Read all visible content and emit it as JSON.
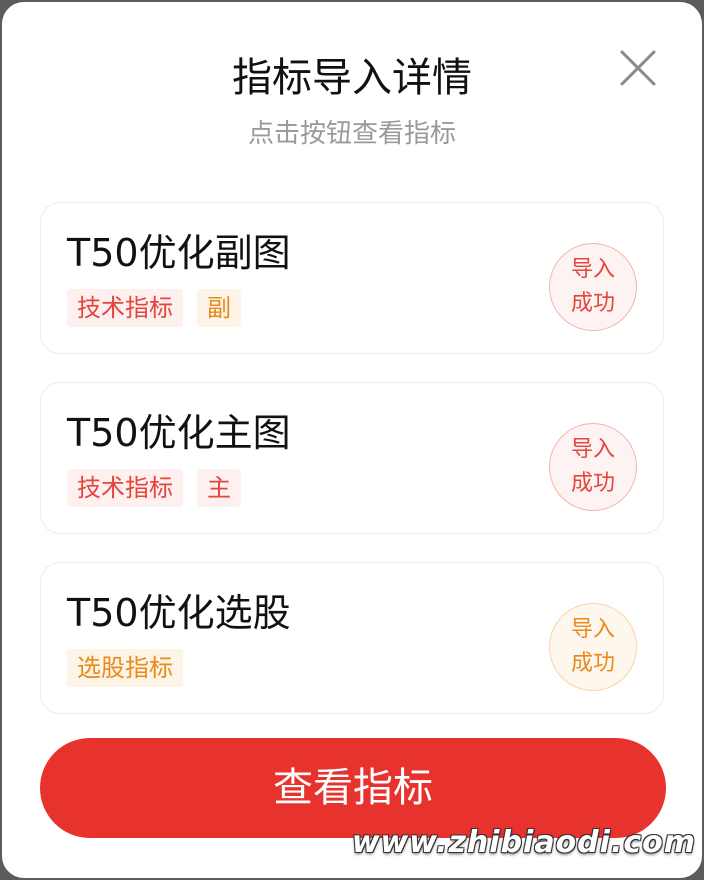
{
  "dialog": {
    "title": "指标导入详情",
    "subtitle": "点击按钮查看指标",
    "close_icon": "close-icon"
  },
  "indicators": [
    {
      "name": "T50优化副图",
      "tags": [
        {
          "label": "技术指标",
          "color": "#e6453c"
        },
        {
          "label": "副",
          "color": "#ea8a1c"
        }
      ],
      "status": "导入成功",
      "status_color": "#e6453c"
    },
    {
      "name": "T50优化主图",
      "tags": [
        {
          "label": "技术指标",
          "color": "#e6453c"
        },
        {
          "label": "主",
          "color": "#e6453c"
        }
      ],
      "status": "导入成功",
      "status_color": "#e6453c"
    },
    {
      "name": "T50优化选股",
      "tags": [
        {
          "label": "选股指标",
          "color": "#ea8a1c"
        }
      ],
      "status": "导入成功",
      "status_color": "#ea8a1c"
    }
  ],
  "primary_button": {
    "label": "查看指标",
    "color": "#e8322e"
  },
  "watermark": "www.zhibiaodi.com"
}
